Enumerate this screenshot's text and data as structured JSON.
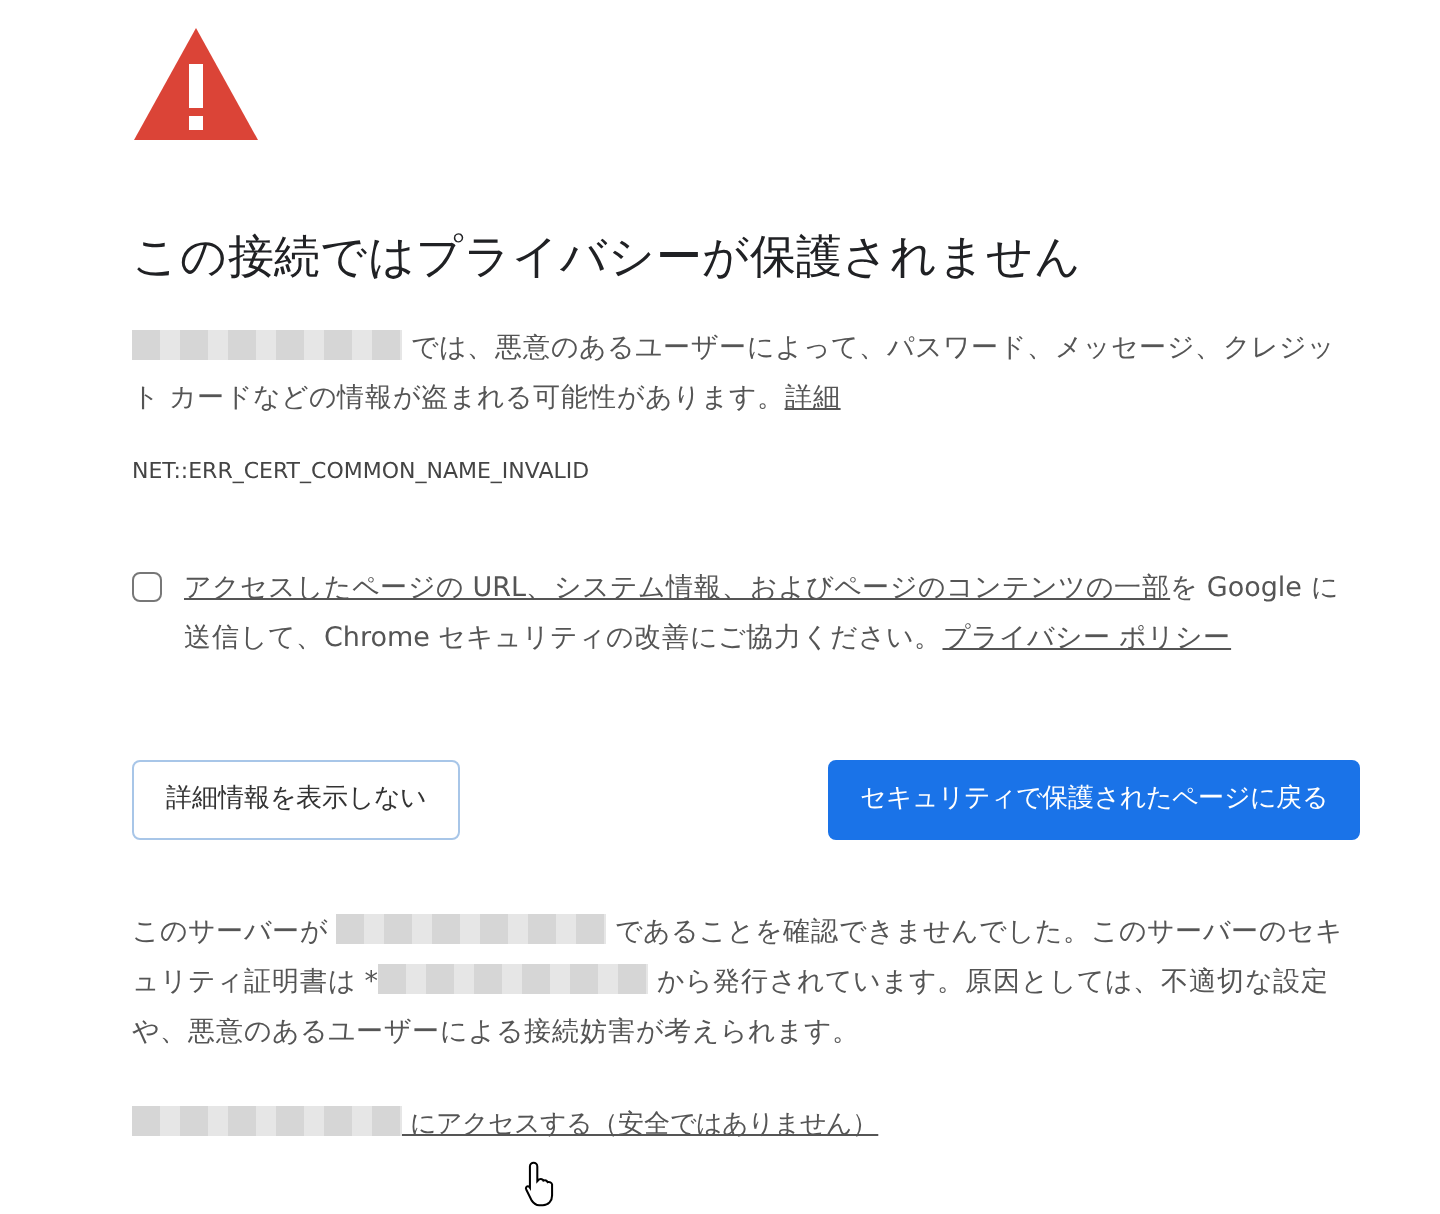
{
  "heading": "この接続ではプライバシーが保護されません",
  "description": {
    "parts": [
      {
        "kind": "redacted"
      },
      {
        "kind": "text",
        "text": " では、悪意のあるユーザーによって、パスワード、メッセージ、クレジット カードなどの情報が盗まれる可能性があります。"
      },
      {
        "kind": "link",
        "text": "詳細"
      }
    ]
  },
  "error_code": "NET::ERR_CERT_COMMON_NAME_INVALID",
  "report": {
    "checked": false,
    "parts": [
      {
        "kind": "link",
        "text": "アクセスしたページの URL、システム情報、およびページのコンテンツの一部"
      },
      {
        "kind": "text",
        "text": "を Google に送信して、Chrome セキュリティの改善にご協力ください。"
      },
      {
        "kind": "link",
        "text": "プライバシー ポリシー"
      }
    ]
  },
  "buttons": [
    {
      "label": "詳細情報を表示しない",
      "kind": "secondary"
    },
    {
      "label": "セキュリティで保護されたページに戻る",
      "kind": "primary"
    }
  ],
  "details": {
    "parts": [
      {
        "kind": "text",
        "text": "このサーバーが "
      },
      {
        "kind": "redacted"
      },
      {
        "kind": "text",
        "text": " であることを確認できませんでした。このサーバーのセキュリティ証明書は *"
      },
      {
        "kind": "redacted"
      },
      {
        "kind": "text",
        "text": " から発行されています。原因としては、不適切な設定や、悪意のあるユーザーによる接続妨害が考えられます。"
      }
    ]
  },
  "proceed_link": {
    "parts": [
      {
        "kind": "redacted"
      },
      {
        "kind": "text",
        "text": " にアクセスする（安全ではありません）"
      }
    ]
  }
}
